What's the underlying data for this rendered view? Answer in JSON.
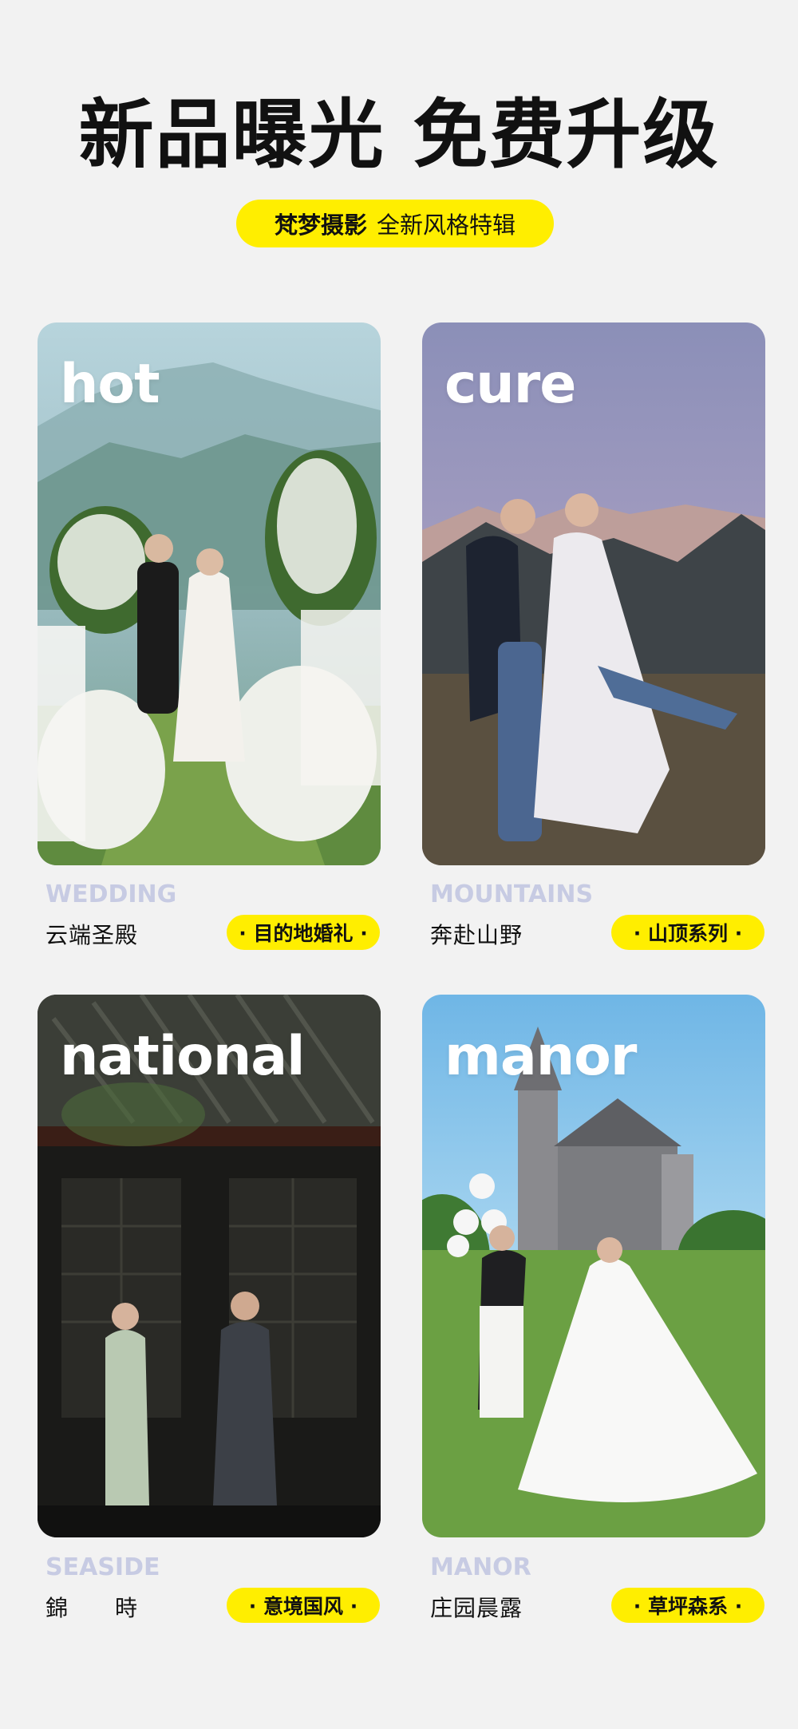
{
  "headline": "新品曝光 免费升级",
  "subtitle": {
    "brand": "梵梦摄影",
    "desc": "全新风格特辑"
  },
  "cards": [
    {
      "overlay": "hot",
      "en": "WEDDING",
      "cn": "云端圣殿",
      "tag": "· 目的地婚礼 ·",
      "icon": "wedding-ceremony-photo"
    },
    {
      "overlay": "cure",
      "en": "MOUNTAINS",
      "cn": "奔赴山野",
      "tag": "· 山顶系列 ·",
      "icon": "mountain-couple-photo"
    },
    {
      "overlay": "national",
      "en": "SEASIDE",
      "cn": "錦　　時",
      "tag": "· 意境国风 ·",
      "icon": "chinese-courtyard-photo"
    },
    {
      "overlay": "manor",
      "en": "MANOR",
      "cn": "庄园晨露",
      "tag": "· 草坪森系 ·",
      "icon": "manor-lawn-photo"
    }
  ],
  "colors": {
    "background": "#f2f2f2",
    "accent": "#ffee00",
    "en_label": "#c7cbe3",
    "text": "#111111"
  }
}
